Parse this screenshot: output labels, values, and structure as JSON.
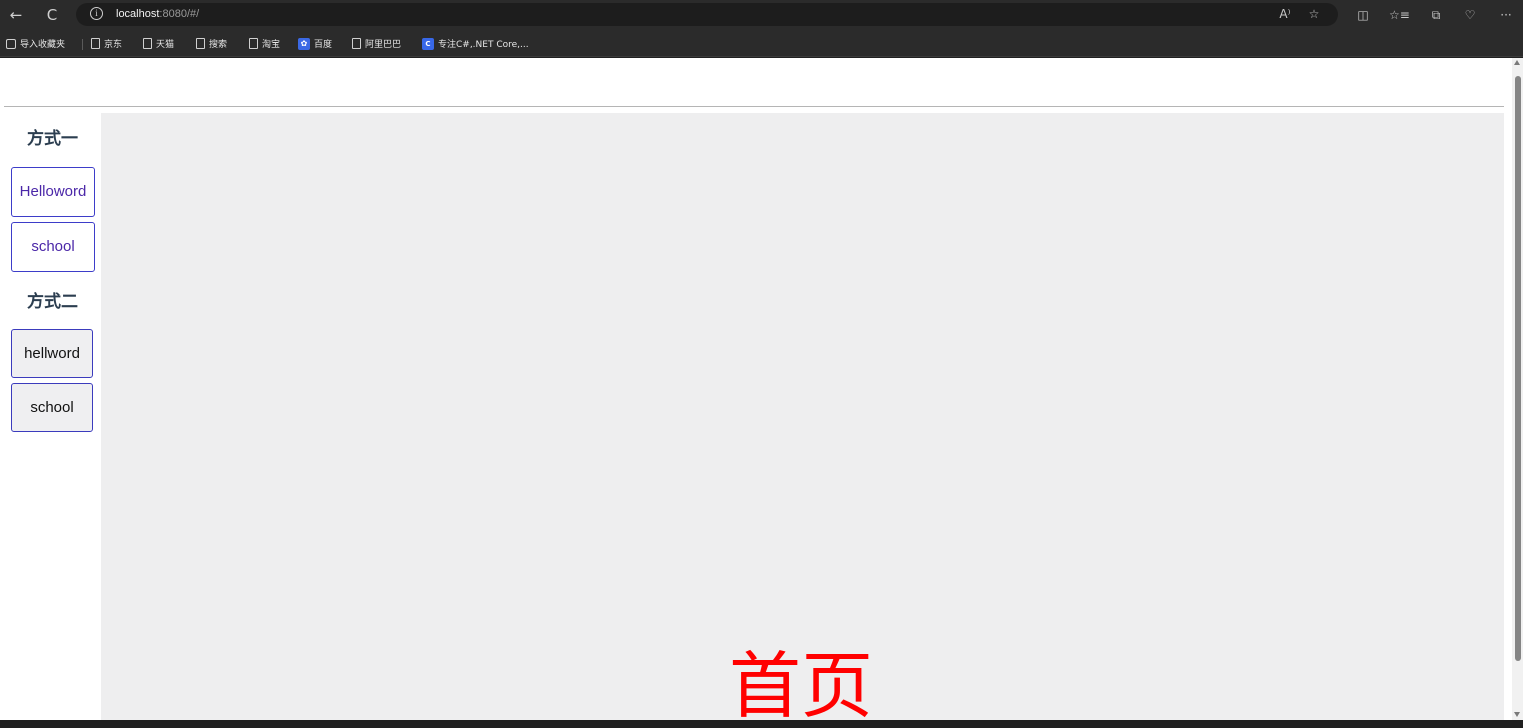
{
  "browser": {
    "url_host": "localhost",
    "url_rest": ":8080/#/",
    "icons": [
      "back-icon",
      "refresh-icon",
      "info-icon",
      "read-aloud-icon",
      "favorite-star-icon",
      "split-screen-icon",
      "favorites-icon",
      "collections-icon",
      "browser-essentials-icon",
      "more-icon"
    ],
    "glyphs": {
      "back": "←",
      "refresh": "C",
      "info": "i",
      "read_aloud": "A⁾",
      "star": "☆",
      "split": "◫",
      "favorites": "☆≡",
      "collections": "⧉",
      "essentials": "♡",
      "more": "···"
    }
  },
  "bookmarks": [
    {
      "label": "导入收藏夹",
      "icon": "import-icon"
    },
    {
      "label": "京东",
      "icon": "page-icon"
    },
    {
      "label": "天猫",
      "icon": "page-icon"
    },
    {
      "label": "搜索",
      "icon": "page-icon"
    },
    {
      "label": "淘宝",
      "icon": "page-icon"
    },
    {
      "label": "百度",
      "icon": "baidu-paw-icon",
      "glyph": "🐾"
    },
    {
      "label": "阿里巴巴",
      "icon": "page-icon"
    },
    {
      "label": "专注C#,.NET Core,...",
      "icon": "brand-icon",
      "glyph": "C"
    }
  ],
  "sidebar": {
    "section1_title": "方式一",
    "section1_links": [
      "Helloword",
      "school"
    ],
    "section2_title": "方式二",
    "section2_buttons": [
      "hellword",
      "school"
    ]
  },
  "main": {
    "title": "首页",
    "title_color": "#ff0000",
    "background": "#eeeeef"
  }
}
